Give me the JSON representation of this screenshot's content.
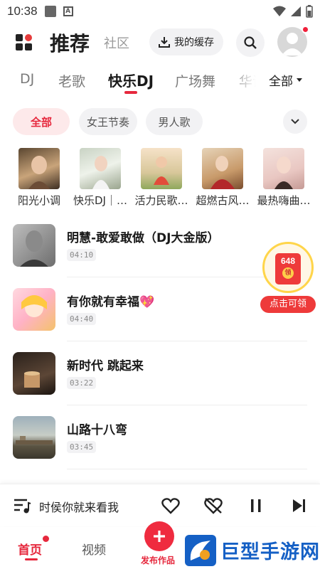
{
  "status_bar": {
    "time": "10:38"
  },
  "header": {
    "title": "推荐",
    "subtitle": "社区",
    "cache_label": "我的缓存"
  },
  "tabs": {
    "items": [
      {
        "label": "DJ",
        "active": false
      },
      {
        "label": "老歌",
        "active": false
      },
      {
        "label": "快乐DJ",
        "active": true
      },
      {
        "label": "广场舞",
        "active": false
      },
      {
        "label": "华语",
        "active": false
      }
    ],
    "all_label": "全部"
  },
  "chips": [
    {
      "label": "全部",
      "active": true
    },
    {
      "label": "女王节奏",
      "active": false
    },
    {
      "label": "男人歌",
      "active": false
    }
  ],
  "playlists": [
    {
      "name": "阳光小调"
    },
    {
      "name": "快乐DJ｜…"
    },
    {
      "name": "活力民歌…"
    },
    {
      "name": "超燃古风…"
    },
    {
      "name": "最热嗨曲…"
    }
  ],
  "songs": [
    {
      "title": "明慧-敢爱敢做（DJ大金版）",
      "duration": "04:10"
    },
    {
      "title": "有你就有幸福💖",
      "duration": "04:40"
    },
    {
      "title": "新时代 跳起来",
      "duration": "03:22"
    },
    {
      "title": "山路十八弯",
      "duration": "03:45"
    }
  ],
  "red_packet": {
    "amount": "648",
    "coin": "领",
    "label": "点击可领"
  },
  "player": {
    "now_playing": "时侯你就来看我"
  },
  "bottom_nav": {
    "home": "首页",
    "video": "视频",
    "publish": "发布作品"
  },
  "watermark": {
    "text": "巨型手游网"
  },
  "colors": {
    "accent": "#e6283d",
    "watermark": "#1560c5"
  }
}
